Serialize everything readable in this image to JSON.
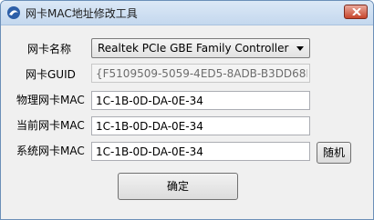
{
  "window": {
    "title": "网卡MAC地址修改工具"
  },
  "labels": {
    "adapter_name": "网卡名称",
    "adapter_guid": "网卡GUID",
    "physical_mac": "物理网卡MAC",
    "current_mac": "当前网卡MAC",
    "system_mac": "系统网卡MAC"
  },
  "adapter_select": {
    "selected": "Realtek PCIe GBE Family Controller"
  },
  "fields": {
    "guid": "{F5109509-5059-4ED5-8ADB-B3DD68F689",
    "physical_mac": "1C-1B-0D-DA-0E-34",
    "current_mac": "1C-1B-0D-DA-0E-34",
    "system_mac": "1C-1B-0D-DA-0E-34"
  },
  "buttons": {
    "random": "随机",
    "ok": "确定"
  },
  "icons": {
    "app": "app-logo-icon",
    "close": "close-icon",
    "dropdown": "chevron-down-icon"
  }
}
